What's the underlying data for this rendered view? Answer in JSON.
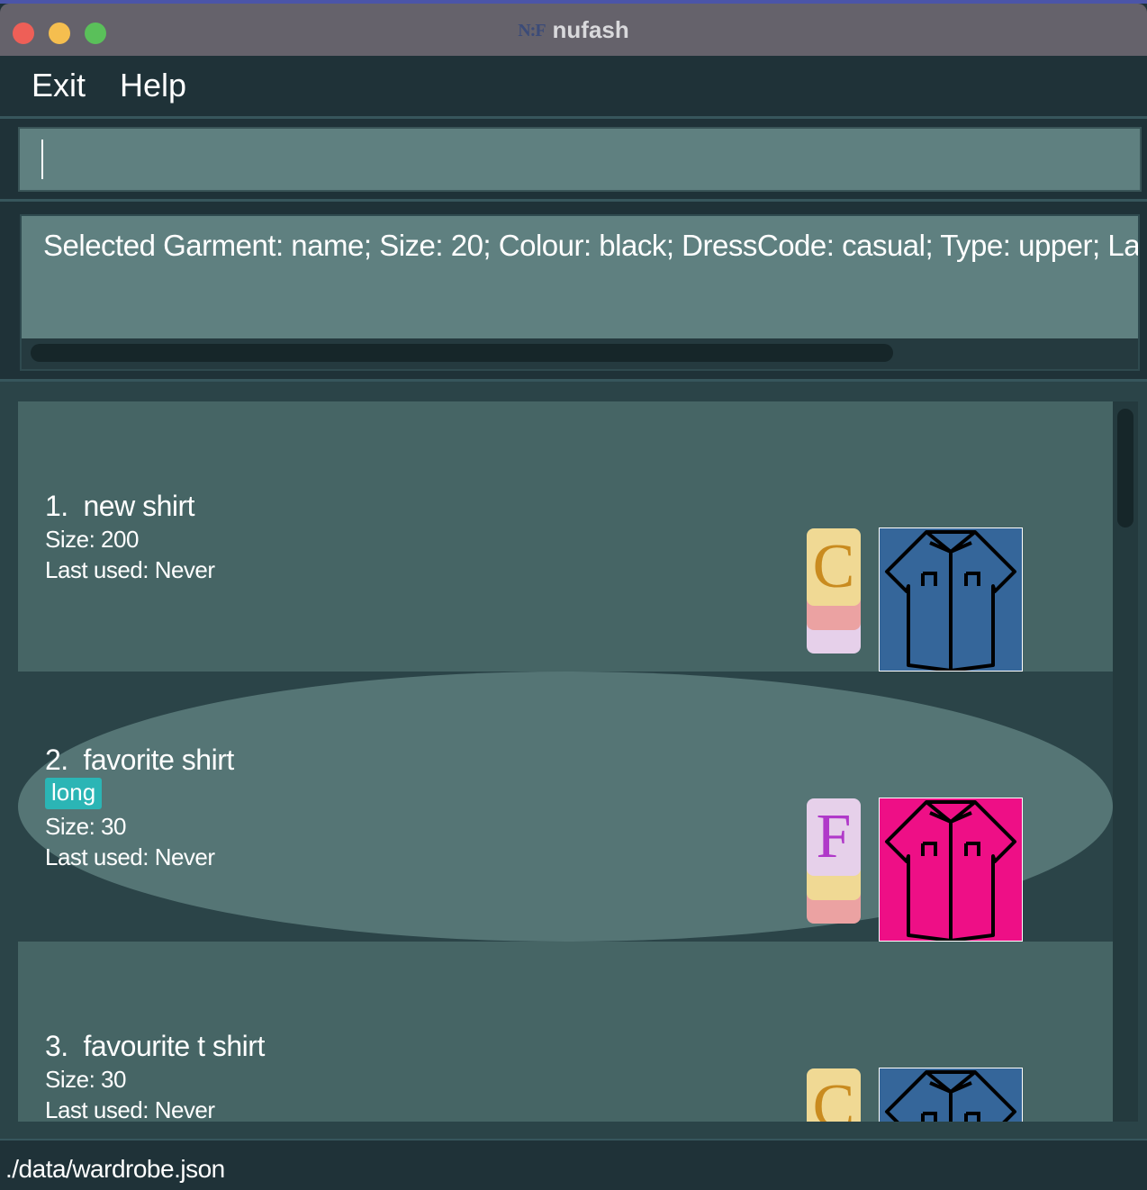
{
  "window": {
    "title": "nufash",
    "logo_text": "N:F"
  },
  "menu": {
    "exit_label": "Exit",
    "help_label": "Help"
  },
  "command_box": {
    "value": "",
    "placeholder": ""
  },
  "result_display": {
    "text": "Selected Garment: name; Size: 20; Colour: black; DressCode: casual; Type: upper; La"
  },
  "garments": [
    {
      "index": "1.",
      "name": "new shirt",
      "tags": [],
      "size": "Size: 200",
      "last_used": "Last used: Never",
      "dresscode_letter": "C",
      "dresscode_color": "#f0d994",
      "letter_color": "#c98b1f",
      "shirt_color": "#35669a",
      "icon": "shirt-icon"
    },
    {
      "index": "2.",
      "name": "favorite shirt",
      "tags": [
        "long"
      ],
      "size": "Size: 30",
      "last_used": "Last used: Never",
      "dresscode_letter": "F",
      "dresscode_color": "#e6d0ea",
      "letter_color": "#b039c9",
      "shirt_color": "#ee0f86",
      "icon": "shirt-icon"
    },
    {
      "index": "3.",
      "name": "favourite t shirt",
      "tags": [],
      "size": "Size: 30",
      "last_used": "Last used: Never",
      "dresscode_letter": "C",
      "dresscode_color": "#f0d994",
      "letter_color": "#c98b1f",
      "shirt_color": "#35669a",
      "icon": "shirt-icon"
    }
  ],
  "statusbar": {
    "path": "./data/wardrobe.json"
  }
}
